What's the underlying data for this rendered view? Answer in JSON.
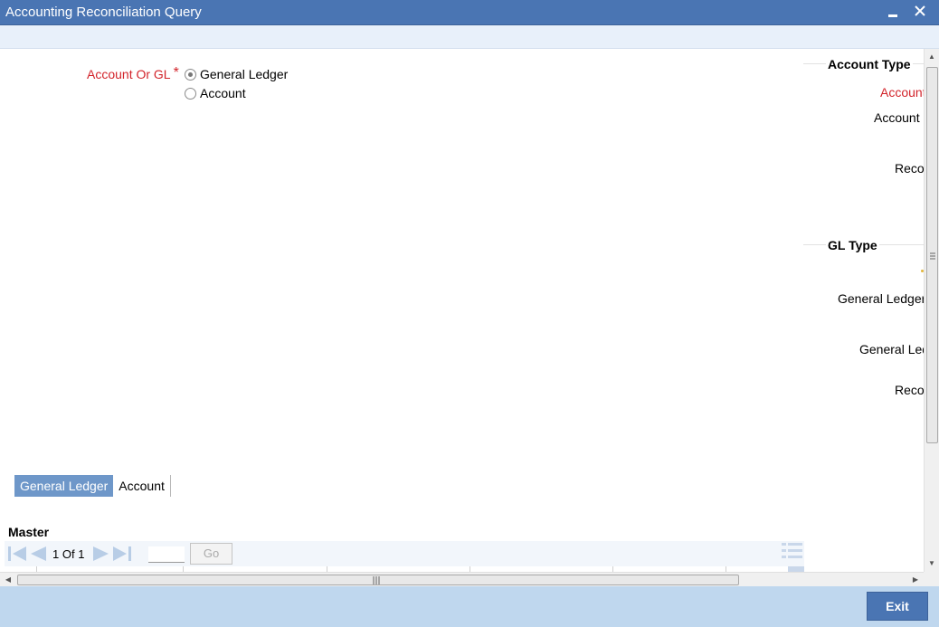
{
  "window": {
    "title": "Accounting Reconciliation Query",
    "minimize_glyph": "▄",
    "close_glyph": "✕"
  },
  "form": {
    "account_or_gl_label": "Account Or GL",
    "required_mark": "*",
    "options": [
      {
        "label": "General Ledger",
        "checked": true
      },
      {
        "label": "Account",
        "checked": false
      }
    ]
  },
  "account_type": {
    "title": "Account Type",
    "fields": [
      "Account",
      "Account (",
      "Reco"
    ]
  },
  "gl_type": {
    "title": "GL Type",
    "fields": [
      "General Ledger (",
      "General Led",
      "Reco"
    ]
  },
  "tabs": [
    {
      "label": "General Ledger",
      "active": true
    },
    {
      "label": "Account",
      "active": false
    }
  ],
  "master": {
    "title": "Master",
    "page_current": "1",
    "page_of": "Of",
    "page_total": "1",
    "page_input_value": "",
    "go_label": "Go"
  },
  "footer": {
    "exit_label": "Exit"
  },
  "colors": {
    "title_bar": "#4a75b3",
    "required_red": "#d2232a",
    "active_tab": "#6e97c9",
    "footer": "#bfd7ee"
  }
}
